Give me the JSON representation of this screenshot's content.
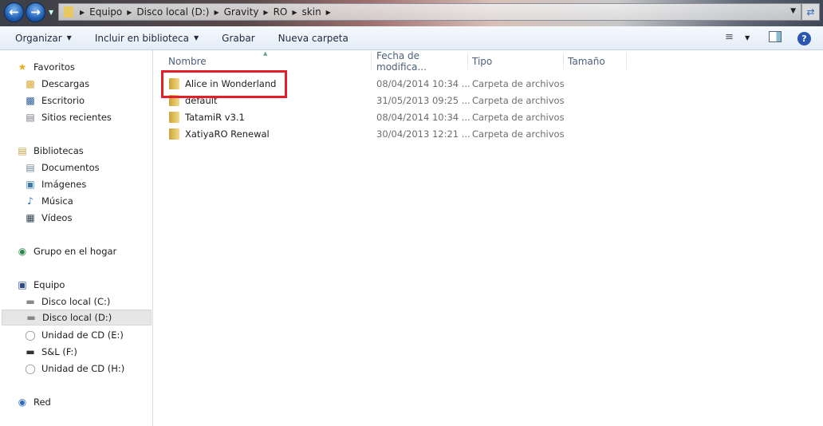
{
  "address_bar": {
    "crumbs": [
      "Equipo",
      "Disco local (D:)",
      "Gravity",
      "RO",
      "skin"
    ]
  },
  "toolbar": {
    "organize": "Organizar",
    "include_library": "Incluir en biblioteca",
    "burn": "Grabar",
    "new_folder": "Nueva carpeta"
  },
  "sidebar": {
    "favorites": {
      "label": "Favoritos",
      "items": [
        "Descargas",
        "Escritorio",
        "Sitios recientes"
      ]
    },
    "libraries": {
      "label": "Bibliotecas",
      "items": [
        "Documentos",
        "Imágenes",
        "Música",
        "Vídeos"
      ]
    },
    "homegroup": "Grupo en el hogar",
    "computer": {
      "label": "Equipo",
      "items": [
        "Disco local (C:)",
        "Disco local (D:)",
        "Unidad de CD (E:)",
        "S&L (F:)",
        "Unidad de CD (H:)"
      ],
      "selected": "Disco local (D:)"
    },
    "network": "Red"
  },
  "columns": {
    "name": "Nombre",
    "date": "Fecha de modifica...",
    "type": "Tipo",
    "size": "Tamaño"
  },
  "files": [
    {
      "name": "Alice in Wonderland",
      "date": "08/04/2014 10:34 ...",
      "type": "Carpeta de archivos",
      "highlighted": true
    },
    {
      "name": "default",
      "date": "31/05/2013 09:25 ...",
      "type": "Carpeta de archivos"
    },
    {
      "name": "TatamiR v3.1",
      "date": "08/04/2014 10:34 ...",
      "type": "Carpeta de archivos"
    },
    {
      "name": "XatiyaRO Renewal",
      "date": "30/04/2013 12:21 ...",
      "type": "Carpeta de archivos"
    }
  ],
  "colors": {
    "highlight": "#e3202a",
    "selection": "#e6e6e6"
  }
}
